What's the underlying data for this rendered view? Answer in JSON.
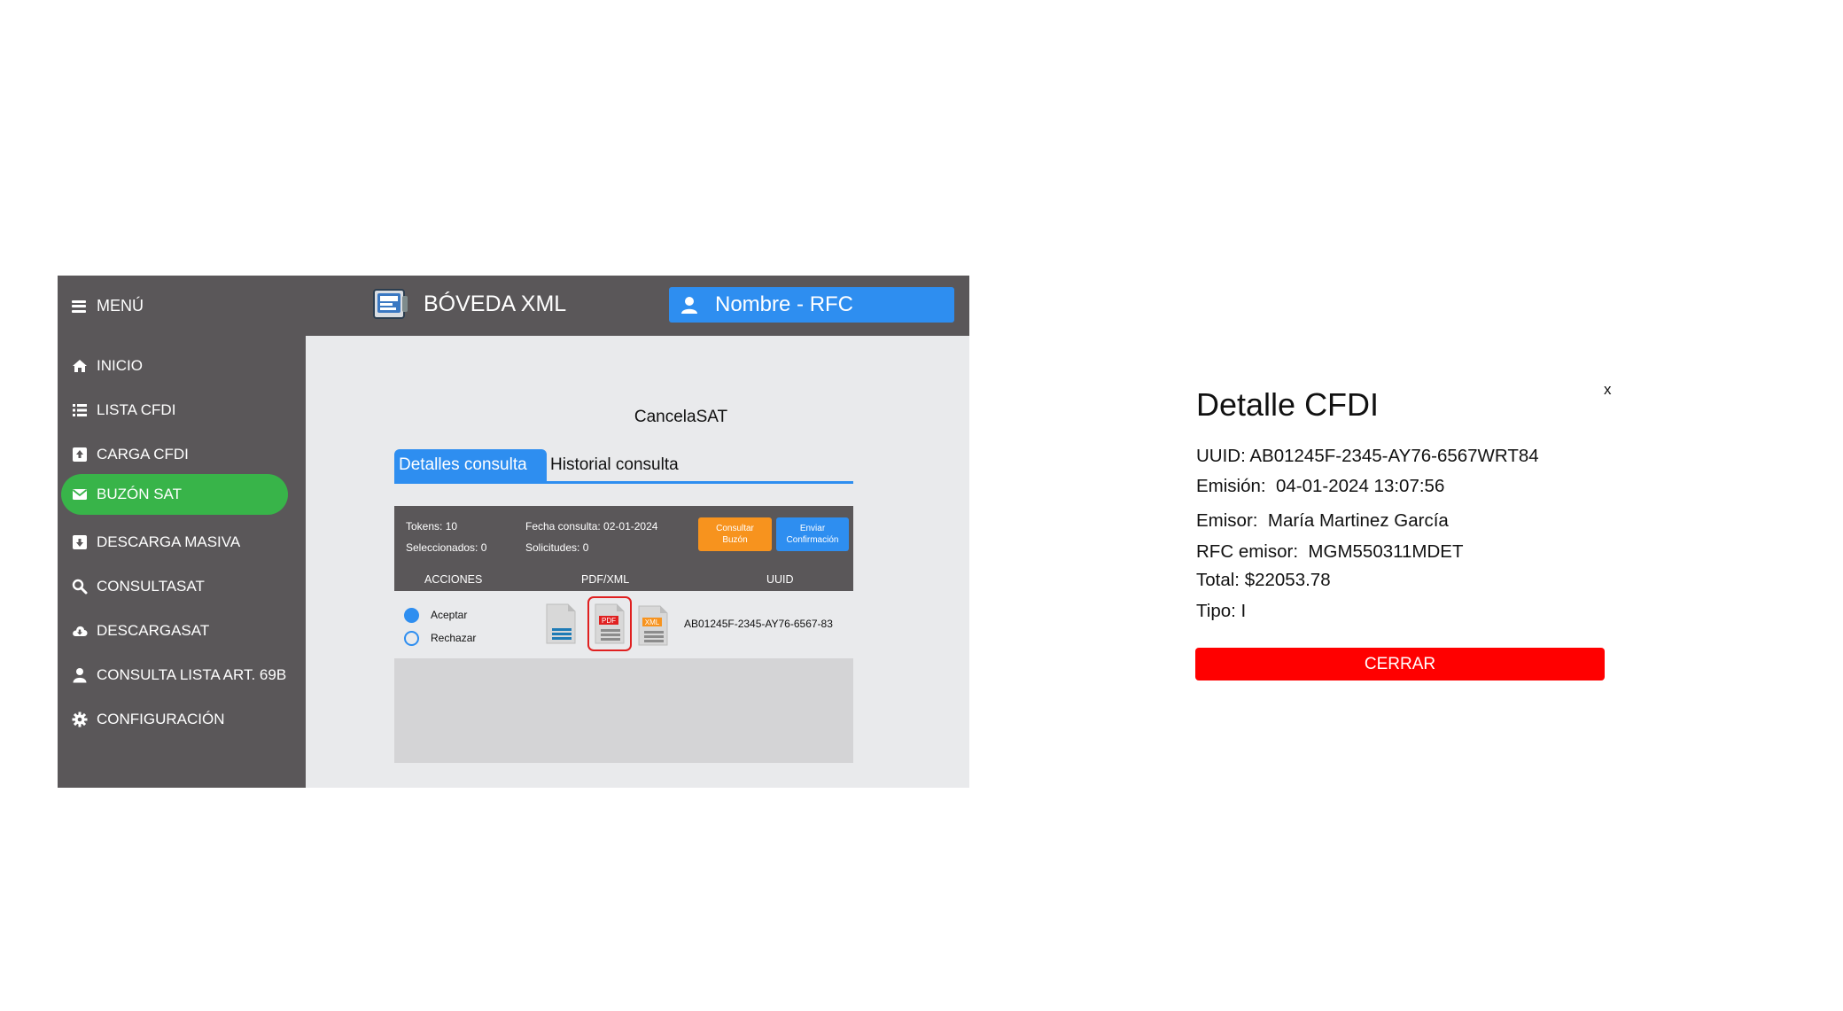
{
  "header": {
    "menu_label": "MENÚ",
    "brand_title": "BÓVEDA XML",
    "user_label": "Nombre - RFC"
  },
  "sidebar": {
    "items": [
      {
        "label": "INICIO",
        "icon": "home-icon"
      },
      {
        "label": "LISTA CFDI",
        "icon": "list-icon"
      },
      {
        "label": "CARGA CFDI",
        "icon": "upload-icon"
      },
      {
        "label": "BUZÓN SAT",
        "icon": "mail-icon",
        "active": true
      },
      {
        "label": "DESCARGA MASIVA",
        "icon": "download-box-icon"
      },
      {
        "label": "CONSULTASAT",
        "icon": "search-icon"
      },
      {
        "label": "DESCARGASAT",
        "icon": "cloud-download-icon"
      },
      {
        "label": "CONSULTA LISTA ART. 69B",
        "icon": "person-icon"
      },
      {
        "label": "CONFIGURACIÓN",
        "icon": "gear-icon"
      }
    ]
  },
  "main": {
    "title": "CancelaSAT",
    "tabs": [
      {
        "label": "Detalles consulta",
        "active": true
      },
      {
        "label": "Historial consulta",
        "active": false
      }
    ],
    "panel": {
      "tokens": "Tokens: 10",
      "seleccionados": "Seleccionados: 0",
      "fecha": "Fecha consulta: 02-01-2024",
      "solicitudes": "Solicitudes: 0",
      "btn_consultar": "Consultar Buzón",
      "btn_enviar": "Enviar Confirmación",
      "columns": [
        "ACCIONES",
        "PDF/XML",
        "UUID"
      ]
    },
    "row": {
      "aceptar": "Aceptar",
      "rechazar": "Rechazar",
      "selected": "Aceptar",
      "pdf_tag": "PDF",
      "xml_tag": "XML",
      "uuid": "AB01245F-2345-AY76-6567-83"
    }
  },
  "modal": {
    "close": "x",
    "title": "Detalle CFDI",
    "uuid": "UUID: AB01245F-2345-AY76-6567WRT84",
    "emision": "Emisión:  04-01-2024 13:07:56",
    "emisor": "Emisor:  María Martinez García",
    "rfc": "RFC emisor:  MGM550311MDET",
    "total": "Total: $22053.78",
    "tipo": "Tipo: I",
    "cerrar": "CERRAR"
  },
  "colors": {
    "sidebar_bg": "#5a5759",
    "accent_blue": "#2e8ef0",
    "active_green": "#38b449",
    "orange": "#f7931e",
    "danger_red": "#ff0000"
  }
}
